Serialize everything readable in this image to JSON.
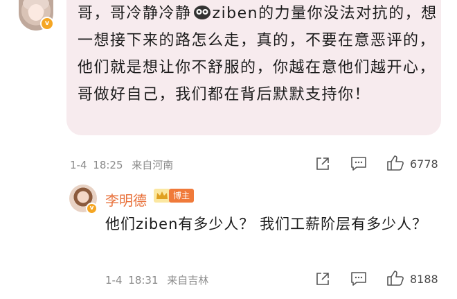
{
  "comment": {
    "text_before_emoji": "哥，哥冷静冷静",
    "emoji_name": "ziben-emoji",
    "text_after_emoji": "ziben的力量你没法对抗的，想一想接下来的路怎么走，真的，不要在意恶评的，他们就是想让你不舒服的，你越在意他们越开心，哥做好自己，我们都在背后默默支持你！",
    "date": "1-4",
    "time": "18:25",
    "location": "来自河南",
    "likes": "6778",
    "bubble_color": "#f7ebee"
  },
  "reply": {
    "author": "李明德",
    "author_badge": "博主",
    "text": "他们ziben有多少人？ 我们工薪阶层有多少人？",
    "date": "1-4",
    "time": "18:31",
    "location": "来自吉林",
    "likes": "8188",
    "name_color": "#e8703a"
  },
  "icons": {
    "share": "share-icon",
    "comment": "comment-icon",
    "like": "thumbs-up-icon",
    "verified": "verified-v-icon",
    "crown": "crown-icon"
  }
}
